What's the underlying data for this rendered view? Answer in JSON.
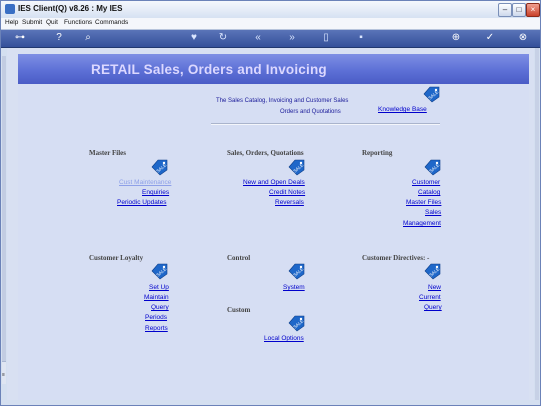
{
  "window": {
    "title": "IES Client(Q) v8.26 : My IES"
  },
  "menu": [
    "Help",
    "Submit",
    "Quit",
    "Functions",
    "Commands"
  ],
  "header": {
    "title": "RETAIL Sales, Orders and Invoicing"
  },
  "intro": {
    "line1": "The Sales Catalog, Invoicing and Customer Sales",
    "line2": "Orders and Quotations",
    "knowledge_base": "Knowledge Base"
  },
  "sections": {
    "master_files": {
      "title": "Master Files",
      "items": [
        "Cust Maintenance",
        "Enquiries",
        "Periodic Updates"
      ]
    },
    "sales": {
      "title": "Sales, Orders, Quotations",
      "items": [
        "New and Open Deals",
        "Credit Notes",
        "Reversals"
      ]
    },
    "reporting": {
      "title": "Reporting",
      "items": [
        "Customer",
        "Catalog",
        "Master Files",
        "Sales",
        "Management"
      ]
    },
    "loyalty": {
      "title": "Customer Loyalty",
      "items": [
        "Set Up",
        "Maintain",
        "Query",
        "Periods",
        "Reports"
      ]
    },
    "control": {
      "title": "Control",
      "items": [
        "System"
      ]
    },
    "custom": {
      "title": "Custom",
      "items": [
        "Local Options"
      ]
    },
    "directives": {
      "title": "Customer Directives: -",
      "items": [
        "New",
        "Current",
        "Query"
      ]
    }
  },
  "icon_label": "SALE",
  "colors": {
    "banner": "#5d70d6",
    "link": "#0000cc",
    "toolbar": "#3f5aa6"
  }
}
